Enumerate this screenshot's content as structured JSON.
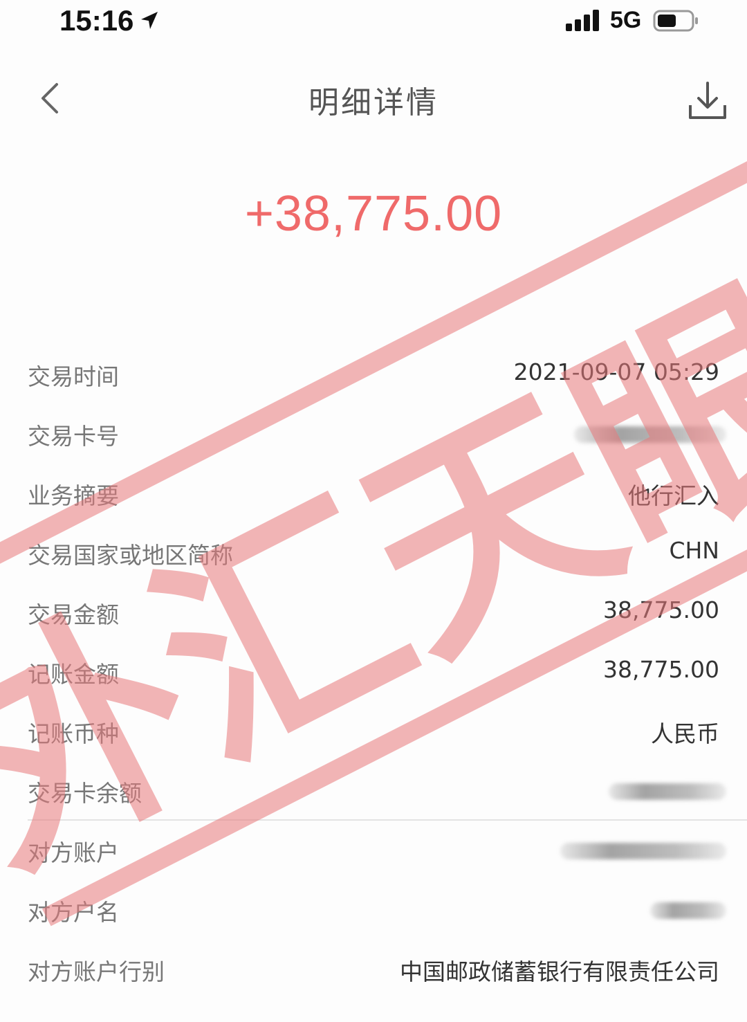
{
  "status_bar": {
    "time": "15:16",
    "network": "5G",
    "icons": [
      "location-arrow-icon",
      "signal-bars-icon",
      "battery-icon"
    ]
  },
  "nav": {
    "title": "明细详情",
    "icons": [
      "back-chevron-icon",
      "download-icon"
    ]
  },
  "amount": "+38,775.00",
  "details_primary": [
    {
      "label": "交易时间",
      "value": "2021-09-07 05:29"
    },
    {
      "label": "交易卡号",
      "value": ""
    },
    {
      "label": "业务摘要",
      "value": "他行汇入"
    },
    {
      "label": "交易国家或地区简称",
      "value": "CHN"
    },
    {
      "label": "交易金额",
      "value": "38,775.00"
    },
    {
      "label": "记账金额",
      "value": "38,775.00"
    },
    {
      "label": "记账币种",
      "value": "人民币"
    },
    {
      "label": "交易卡余额",
      "value": ""
    }
  ],
  "details_counterparty": [
    {
      "label": "对方账户",
      "value": ""
    },
    {
      "label": "对方户名",
      "value": ""
    },
    {
      "label": "对方账户行别",
      "value": "中国邮政储蓄银行有限责任公司"
    }
  ],
  "watermark_text": "外汇天眼",
  "colors": {
    "amount": "#ef6a6a",
    "watermark": "#e8797b",
    "label": "#777777",
    "value": "#333333"
  }
}
